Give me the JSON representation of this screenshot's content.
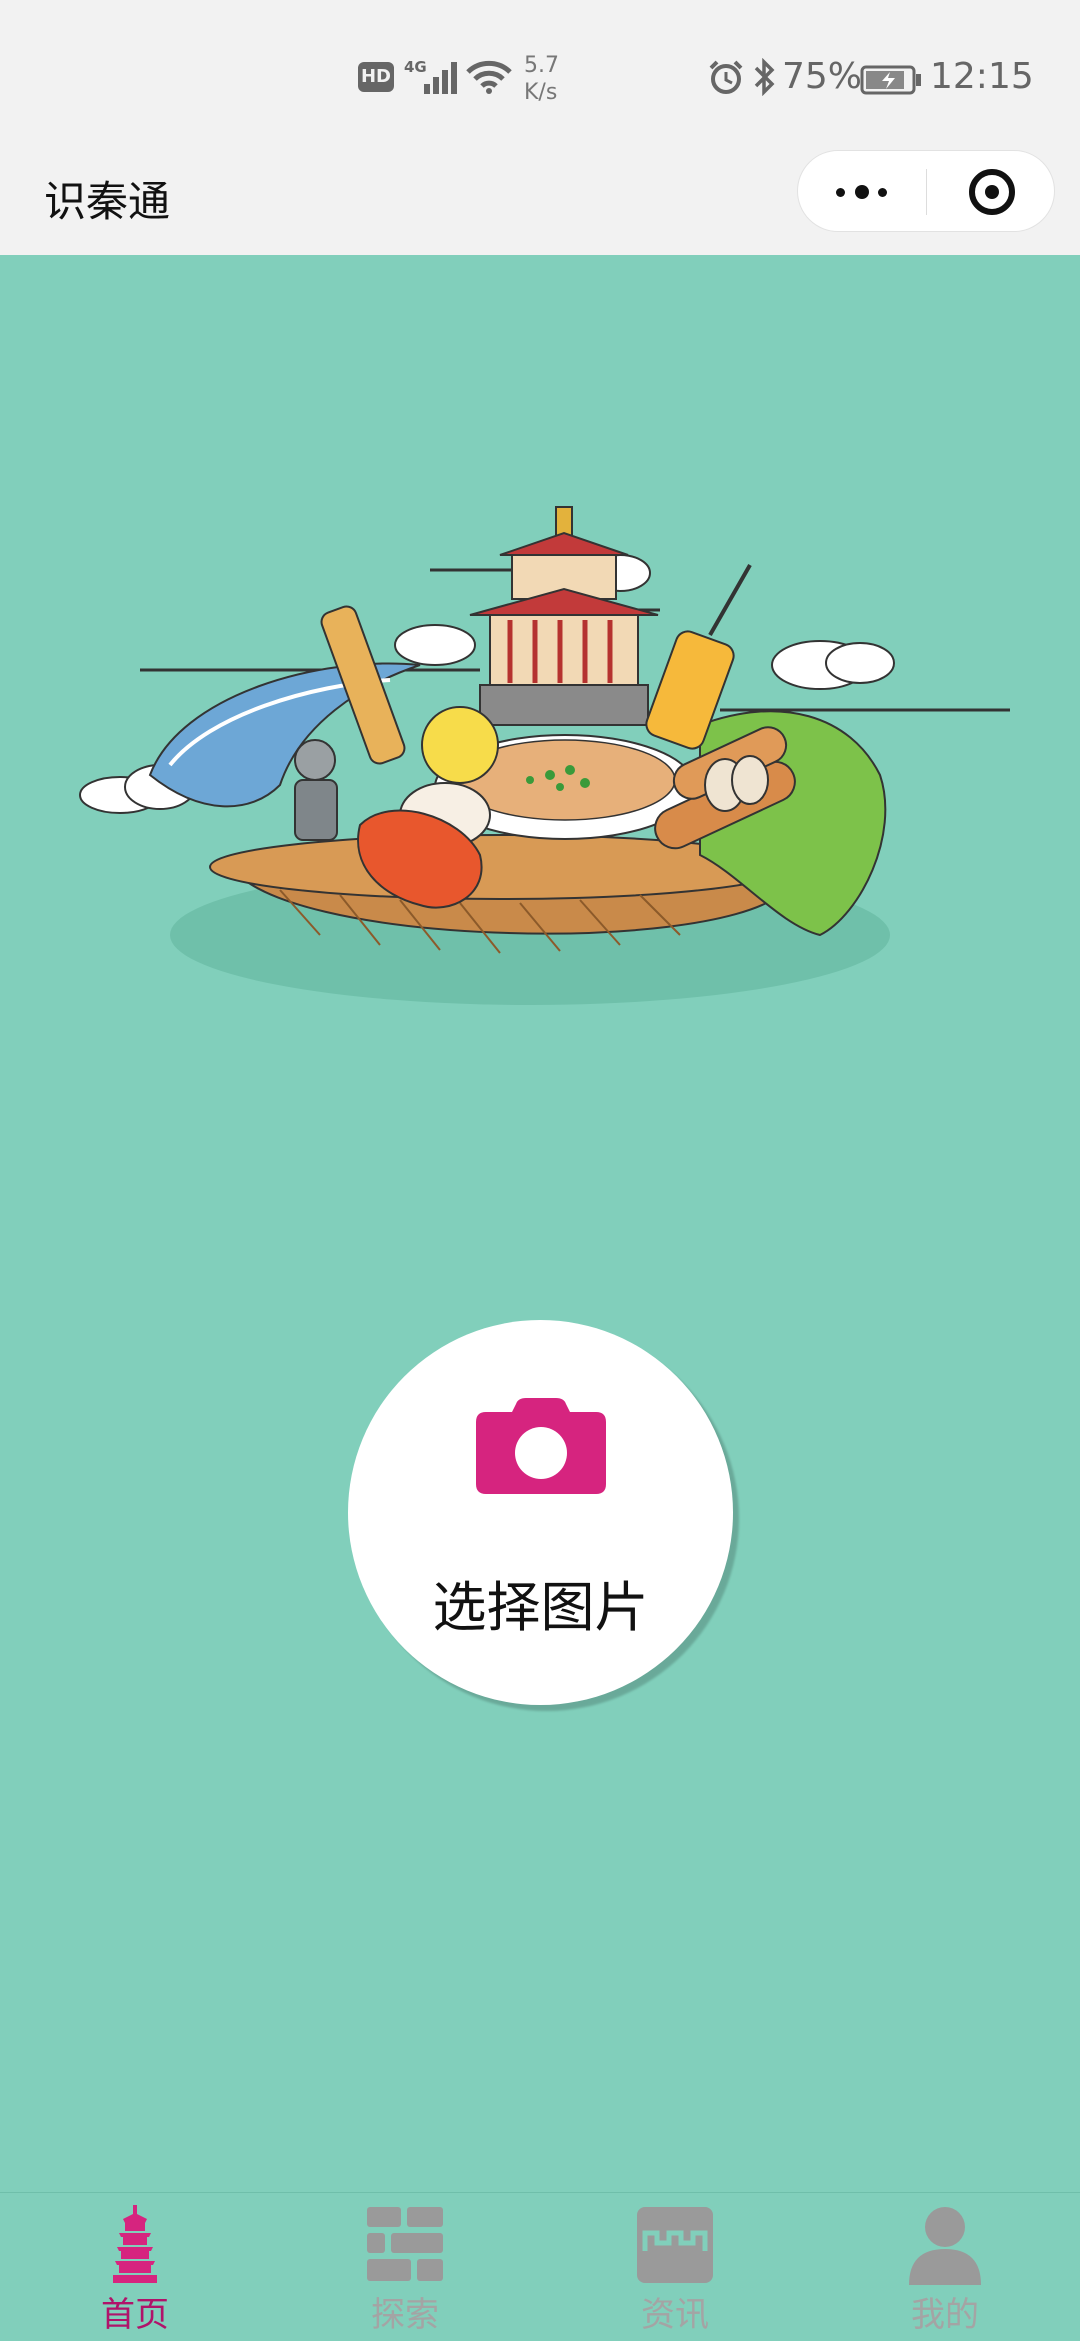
{
  "status_bar": {
    "hd": "HD",
    "network": "4G",
    "speed_value": "5.7",
    "speed_unit": "K/s",
    "battery_percent": "75%",
    "time": "12:15"
  },
  "nav": {
    "title": "识秦通"
  },
  "main": {
    "pick_image_label": "选择图片"
  },
  "tabs": [
    {
      "label": "首页",
      "icon": "pagoda-icon",
      "active": true
    },
    {
      "label": "探索",
      "icon": "grid-icon",
      "active": false
    },
    {
      "label": "资讯",
      "icon": "news-icon",
      "active": false
    },
    {
      "label": "我的",
      "icon": "person-icon",
      "active": false
    }
  ],
  "colors": {
    "background": "#81cfbb",
    "accent": "#d6247f",
    "active_tab": "#b0136a",
    "inactive_tab": "#a4a4a4"
  }
}
